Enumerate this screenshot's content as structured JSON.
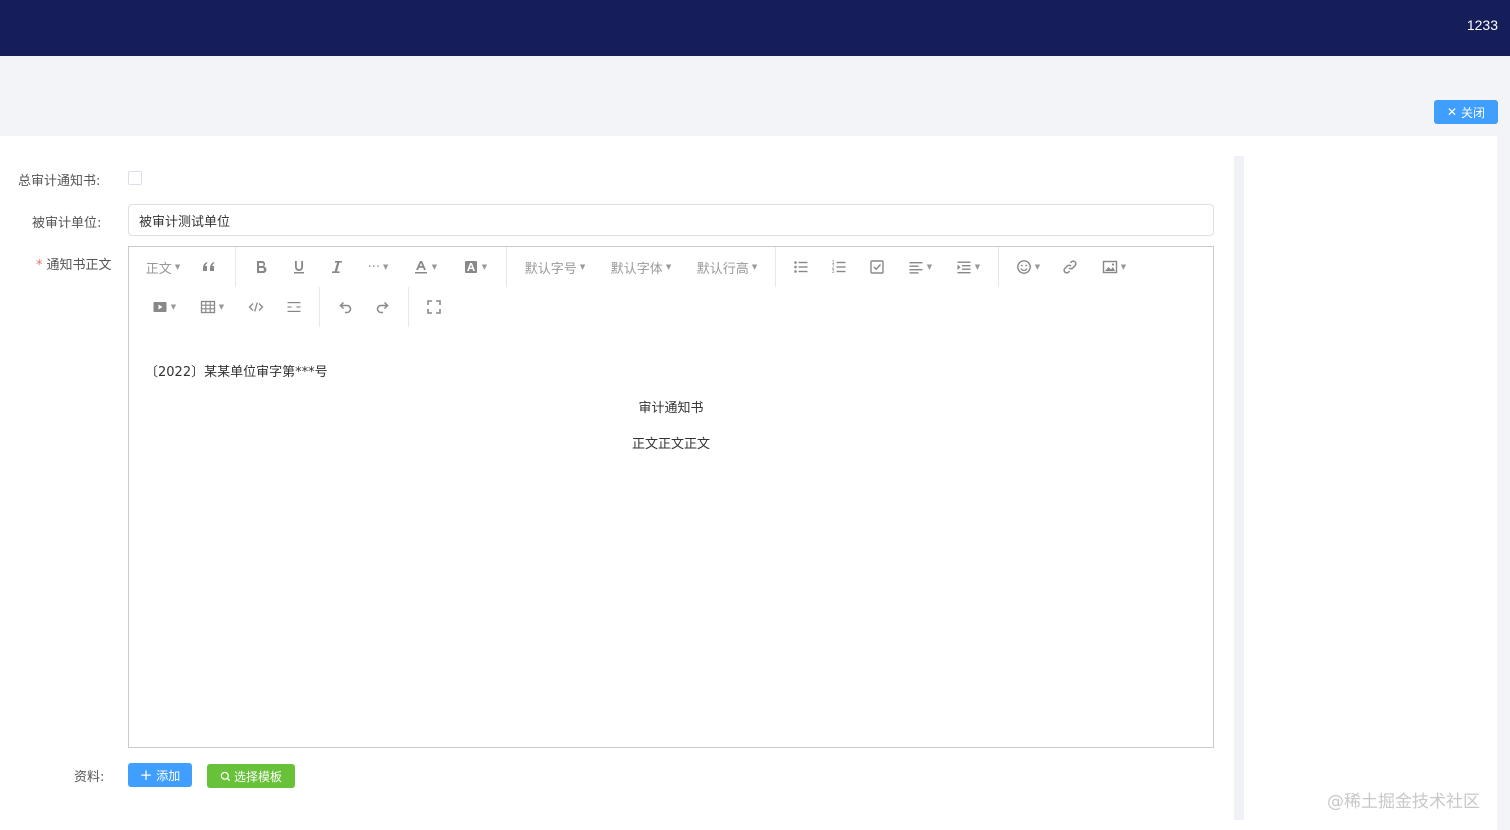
{
  "header": {
    "user": "1233"
  },
  "actions": {
    "close_label": "关闭"
  },
  "form": {
    "total_notice_label": "总审计通知书:",
    "audited_unit_label": "被审计单位:",
    "audited_unit_value": "被审计测试单位",
    "body_label": "通知书正文",
    "required_mark": "*",
    "materials_label": "资料:"
  },
  "toolbar": {
    "paragraph": "正文",
    "font_size": "默认字号",
    "font_family": "默认字体",
    "line_height": "默认行高",
    "more": "···"
  },
  "document": {
    "line1": "〔2022〕某某单位审字第***号",
    "line2": "审计通知书",
    "line3": "正文正文正文"
  },
  "buttons": {
    "add_label": "添加",
    "template_label": "选择模板"
  },
  "watermark": "@稀土掘金技术社区"
}
